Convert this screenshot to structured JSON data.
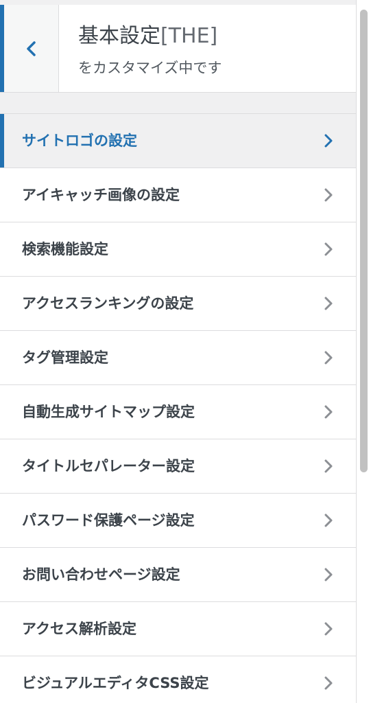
{
  "header": {
    "title": "基本設定",
    "title_suffix": "[THE]",
    "subtitle": "をカスタマイズ中です",
    "back_icon": "chevron-left-icon"
  },
  "menu": {
    "items": [
      {
        "label": "サイトロゴの設定",
        "active": true
      },
      {
        "label": "アイキャッチ画像の設定",
        "active": false
      },
      {
        "label": "検索機能設定",
        "active": false
      },
      {
        "label": "アクセスランキングの設定",
        "active": false
      },
      {
        "label": "タグ管理設定",
        "active": false
      },
      {
        "label": "自動生成サイトマップ設定",
        "active": false
      },
      {
        "label": "タイトルセパレーター設定",
        "active": false
      },
      {
        "label": "パスワード保護ページ設定",
        "active": false
      },
      {
        "label": "お問い合わせページ設定",
        "active": false
      },
      {
        "label": "アクセス解析設定",
        "active": false
      },
      {
        "label": "ビジュアルエディタCSS設定",
        "active": false
      }
    ],
    "item_icon": "chevron-right-icon"
  },
  "colors": {
    "accent": "#2271b1",
    "text": "#3c434a",
    "chevron": "#8c8f94",
    "background": "#f0f0f1",
    "border": "#dcdcde"
  }
}
